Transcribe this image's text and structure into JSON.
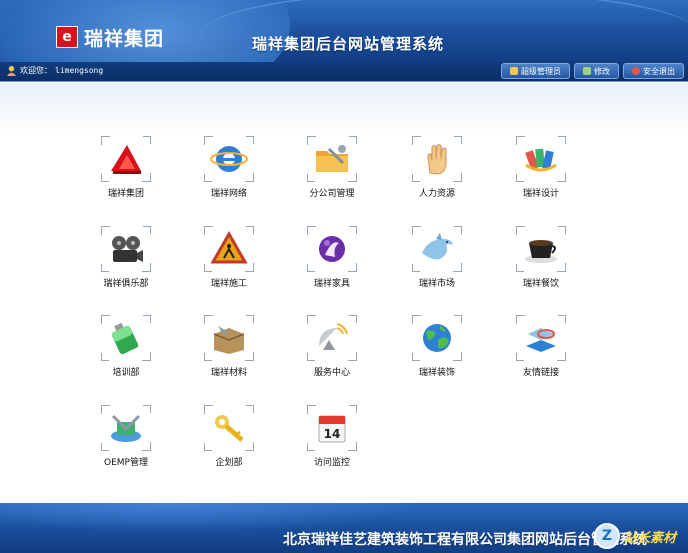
{
  "header": {
    "logo_mark": "e",
    "logo_text": "瑞祥集团",
    "system_title": "瑞祥集团后台网站管理系统"
  },
  "userbar": {
    "welcome_label": "欢迎您：",
    "username": "limengsong",
    "buttons": [
      {
        "label": "超级管理员",
        "icon": "user-badge-icon",
        "color": "#f2c94c"
      },
      {
        "label": "修改",
        "icon": "edit-icon",
        "color": "#9fd37a"
      },
      {
        "label": "安全退出",
        "icon": "exit-icon",
        "color": "#e2574c"
      }
    ]
  },
  "modules": [
    {
      "label": "瑞祥集团",
      "icon": "ruixiang-group-icon"
    },
    {
      "label": "瑞祥网络",
      "icon": "ie-browser-icon"
    },
    {
      "label": "分公司管理",
      "icon": "folder-tools-icon"
    },
    {
      "label": "人力资源",
      "icon": "hand-icon"
    },
    {
      "label": "瑞祥设计",
      "icon": "color-palette-icon"
    },
    {
      "label": "瑞祥俱乐部",
      "icon": "film-projector-icon"
    },
    {
      "label": "瑞祥施工",
      "icon": "construction-sign-icon"
    },
    {
      "label": "瑞祥家具",
      "icon": "purple-orb-icon"
    },
    {
      "label": "瑞祥市场",
      "icon": "dolphin-icon"
    },
    {
      "label": "瑞祥餐饮",
      "icon": "coffee-cup-icon"
    },
    {
      "label": "培训部",
      "icon": "green-battery-icon"
    },
    {
      "label": "瑞祥材料",
      "icon": "box-materials-icon"
    },
    {
      "label": "服务中心",
      "icon": "satellite-dish-icon"
    },
    {
      "label": "瑞祥装饰",
      "icon": "globe-icon"
    },
    {
      "label": "友情链接",
      "icon": "link-book-icon"
    },
    {
      "label": "OEMP管理",
      "icon": "computer-tools-icon"
    },
    {
      "label": "企划部",
      "icon": "key-icon"
    },
    {
      "label": "访问监控",
      "icon": "calendar-icon"
    }
  ],
  "calendar_day": "14",
  "footer": {
    "text": "北京瑞祥佳艺建筑装饰工程有限公司集团网站后台管理系统",
    "watermark_text": "站长素材"
  }
}
